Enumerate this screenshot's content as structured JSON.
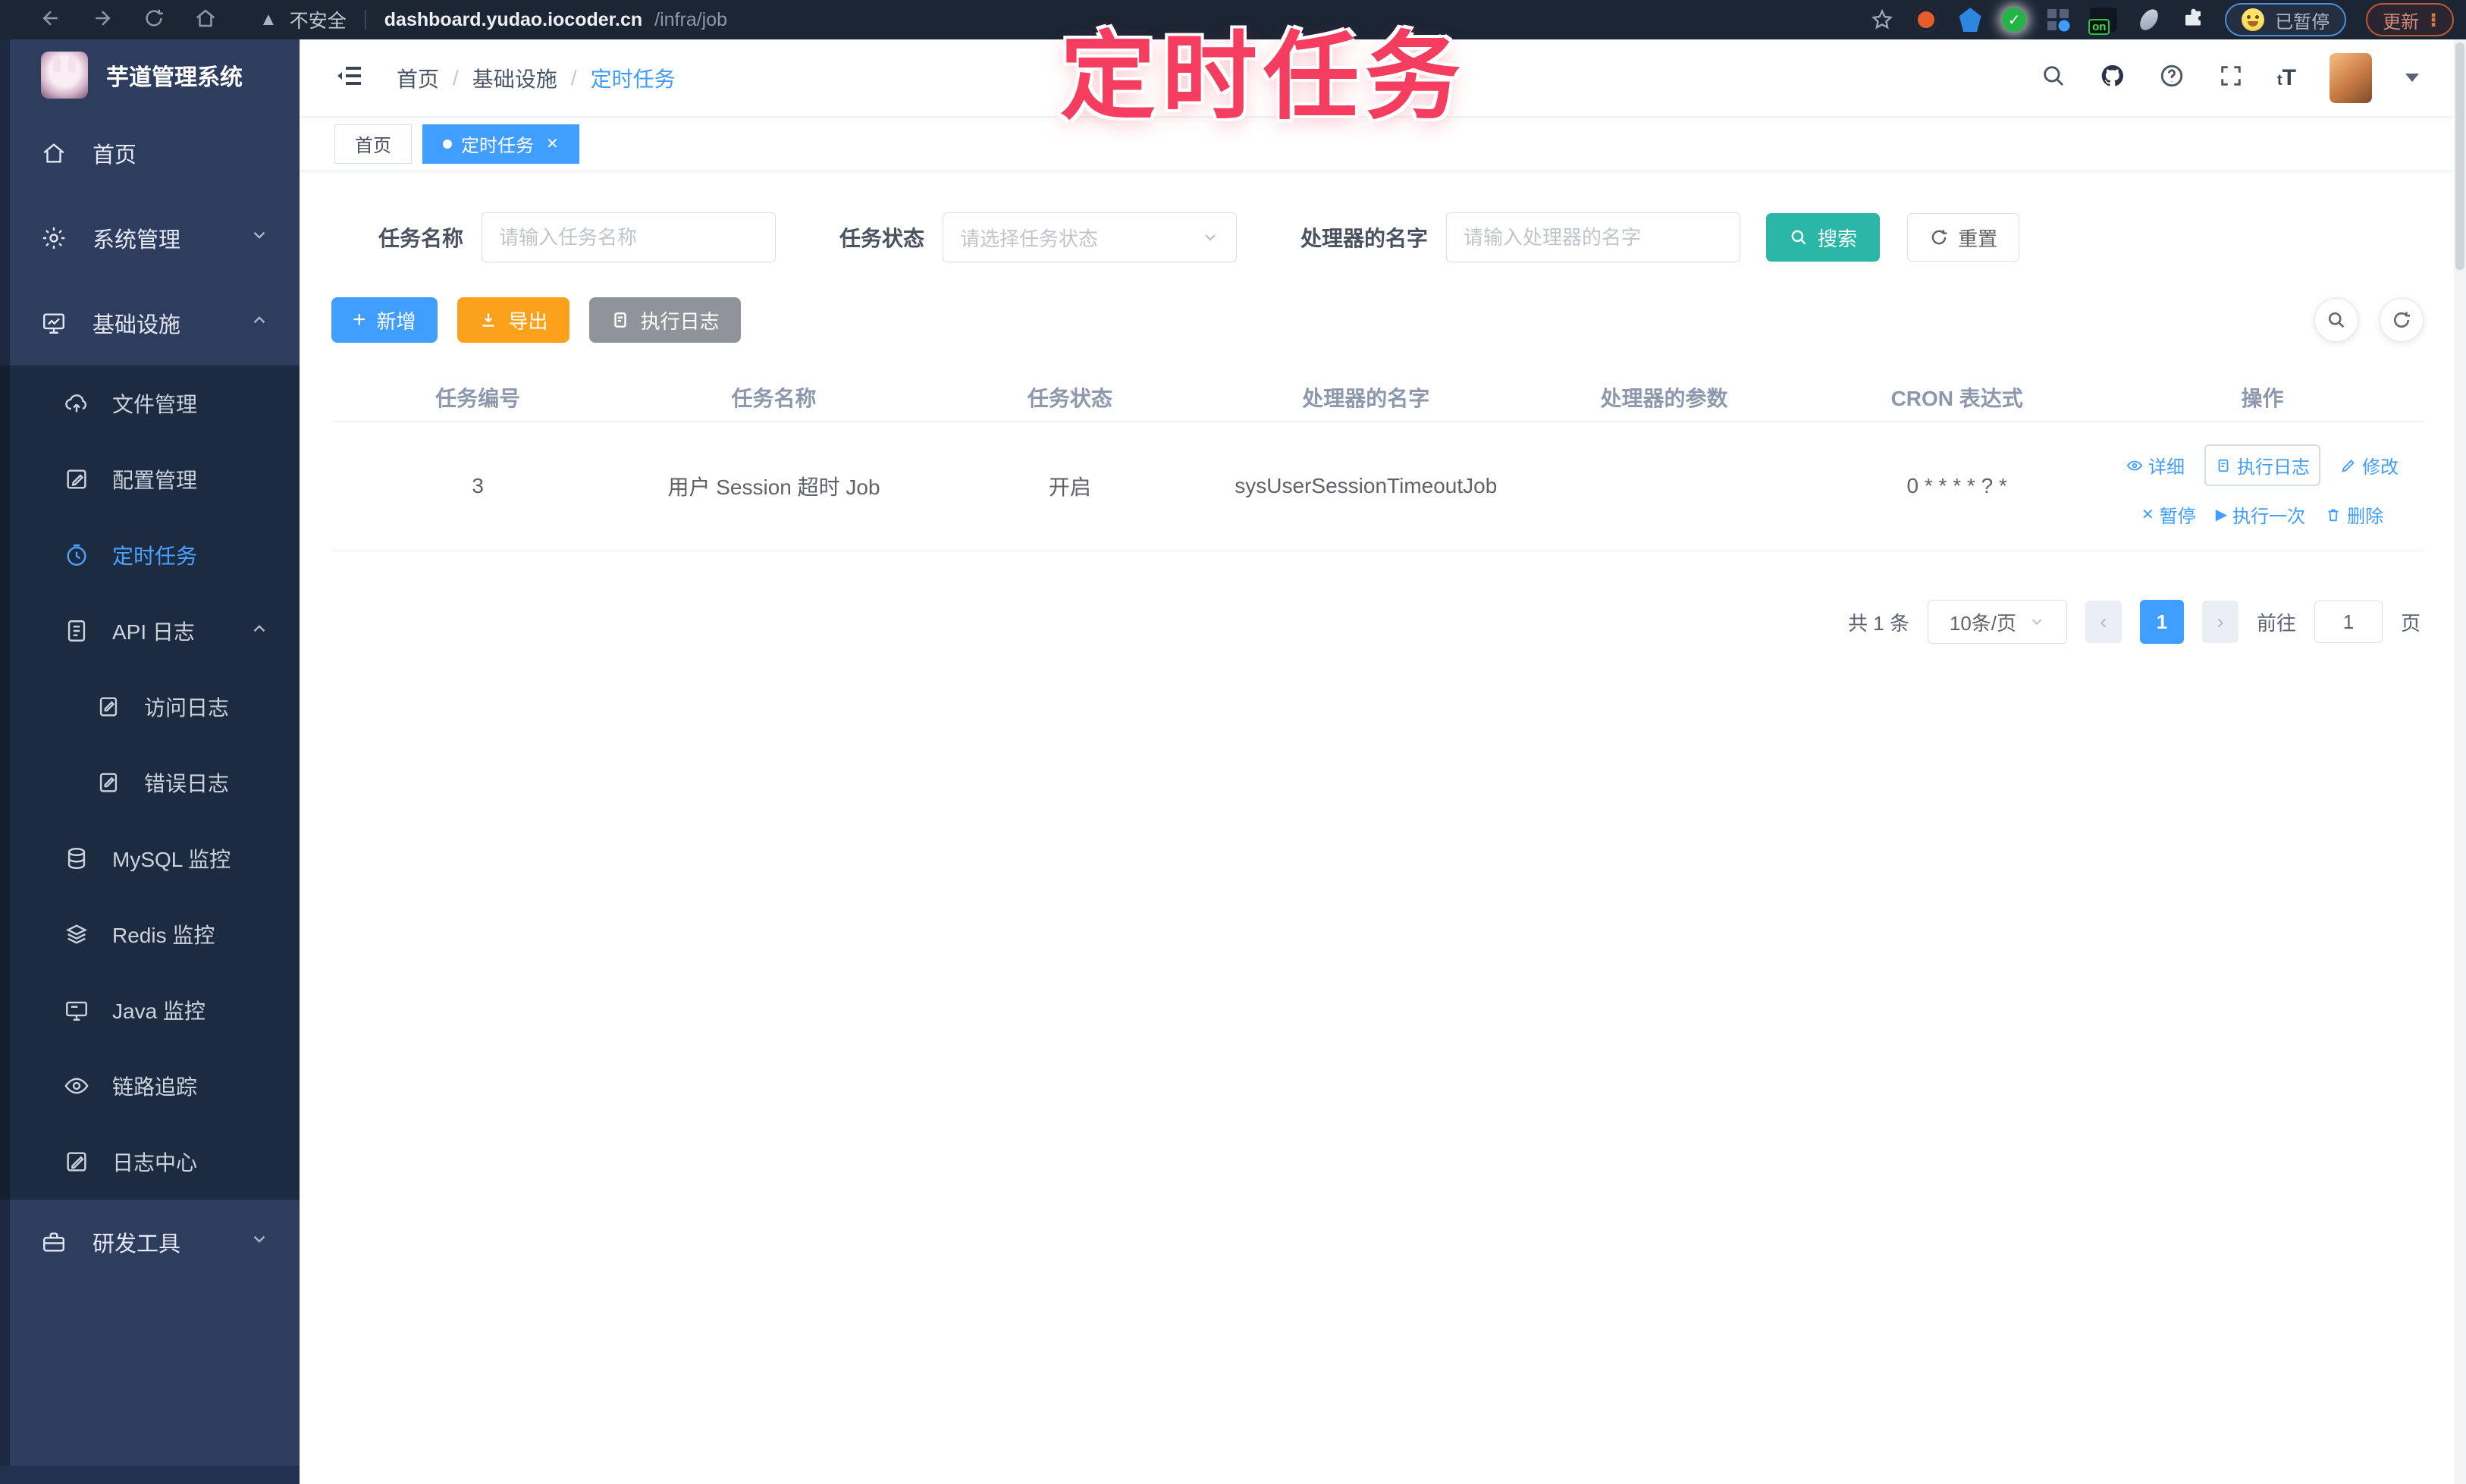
{
  "browser": {
    "security_label": "不安全",
    "url_domain": "dashboard.yudao.iocoder.cn",
    "url_path": "/infra/job",
    "extension_on_badge": "on",
    "paused_label": "已暂停",
    "update_label": "更新"
  },
  "watermark": "定时任务",
  "sidebar": {
    "logo_title": "芋道管理系统",
    "items": [
      {
        "label": "首页"
      },
      {
        "label": "系统管理"
      },
      {
        "label": "基础设施"
      },
      {
        "label": "文件管理"
      },
      {
        "label": "配置管理"
      },
      {
        "label": "定时任务"
      },
      {
        "label": "API 日志"
      },
      {
        "label": "访问日志"
      },
      {
        "label": "错误日志"
      },
      {
        "label": "MySQL 监控"
      },
      {
        "label": "Redis 监控"
      },
      {
        "label": "Java 监控"
      },
      {
        "label": "链路追踪"
      },
      {
        "label": "日志中心"
      },
      {
        "label": "研发工具"
      }
    ]
  },
  "breadcrumb": {
    "items": [
      "首页",
      "基础设施",
      "定时任务"
    ]
  },
  "tabs": [
    {
      "label": "首页"
    },
    {
      "label": "定时任务"
    }
  ],
  "filters": {
    "name_label": "任务名称",
    "name_placeholder": "请输入任务名称",
    "status_label": "任务状态",
    "status_placeholder": "请选择任务状态",
    "handler_label": "处理器的名字",
    "handler_placeholder": "请输入处理器的名字",
    "search_label": "搜索",
    "reset_label": "重置"
  },
  "toolbar": {
    "add_label": "新增",
    "export_label": "导出",
    "exec_log_label": "执行日志"
  },
  "table": {
    "headers": [
      "任务编号",
      "任务名称",
      "任务状态",
      "处理器的名字",
      "处理器的参数",
      "CRON 表达式",
      "操作"
    ],
    "row": {
      "id": "3",
      "name": "用户 Session 超时 Job",
      "status": "开启",
      "handler": "sysUserSessionTimeoutJob",
      "params": "",
      "cron": "0 * * * * ? *",
      "op_detail": "详细",
      "op_exec_log": "执行日志",
      "op_edit": "修改",
      "op_pause": "暂停",
      "op_run_once": "执行一次",
      "op_delete": "删除"
    }
  },
  "pagination": {
    "total": "共 1 条",
    "page_size": "10条/页",
    "current_page": "1",
    "goto_label": "前往",
    "goto_value": "1",
    "page_unit": "页"
  },
  "colors": {
    "accent_blue": "#409EFF",
    "search_teal": "#2BB7A8",
    "export_orange": "#FBA11C",
    "gray_button": "#909399",
    "watermark_pink": "#F53D60",
    "sidebar_bg": "#2E3D5E",
    "submenu_bg": "#1D2B40",
    "browser_bar_bg": "#1B2534"
  }
}
